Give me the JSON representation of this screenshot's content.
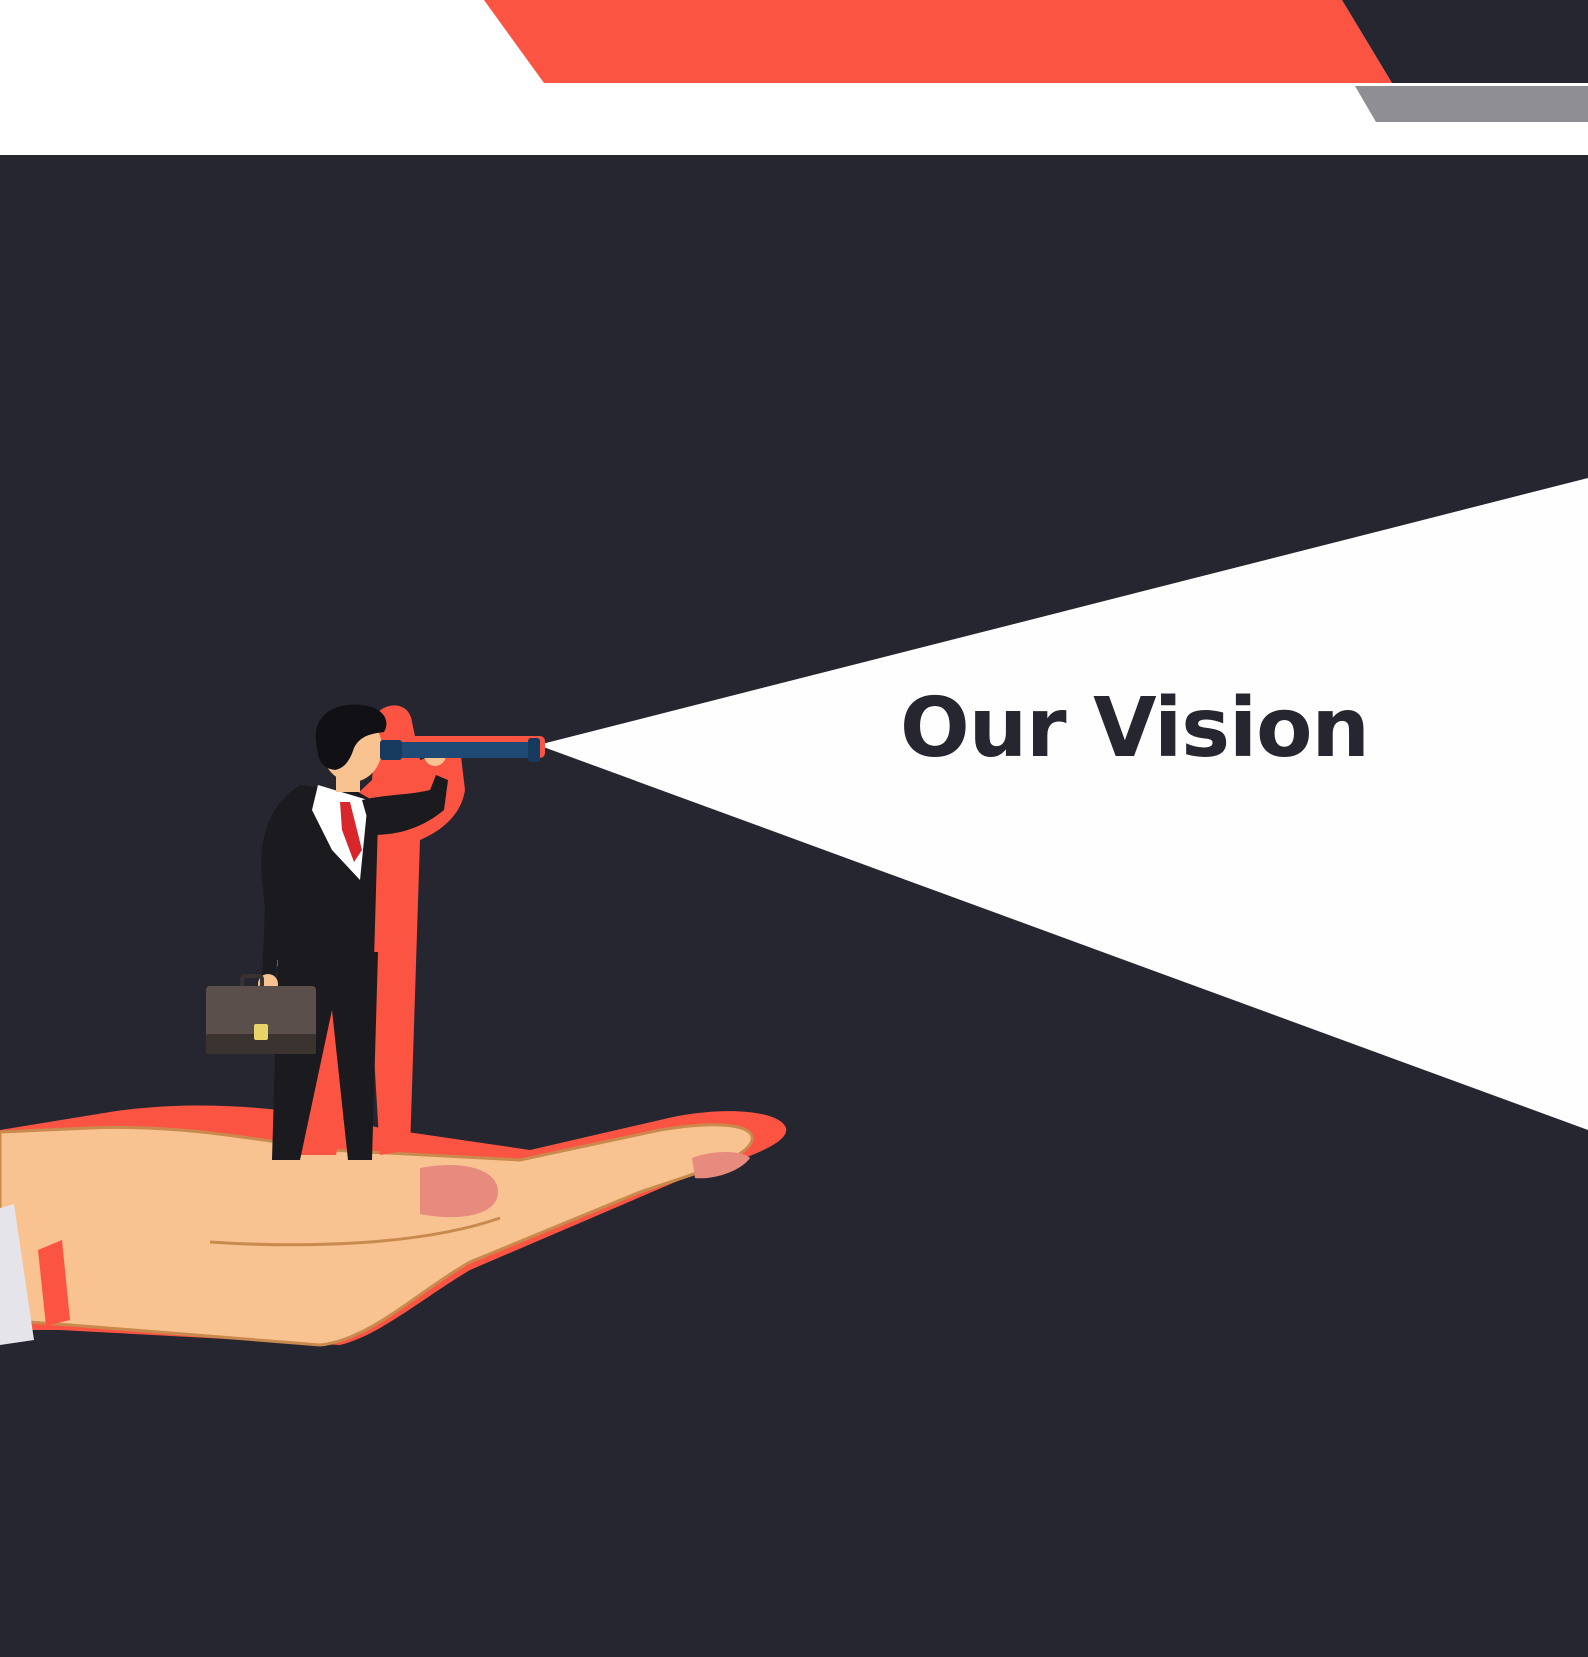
{
  "slide": {
    "title": "Our Vision"
  },
  "colors": {
    "accent": "#fc5443",
    "dark": "#262630",
    "gray": "#8e8e93",
    "white": "#ffffff",
    "skin": "#f8c291",
    "skin_outline": "#c98a4e",
    "suit": "#1a1a1f",
    "tie": "#d8262c",
    "briefcase": "#5b4f4c",
    "telescope": "#1f4a75"
  },
  "icons": {
    "illustration": "businessman-with-telescope-on-hand"
  }
}
